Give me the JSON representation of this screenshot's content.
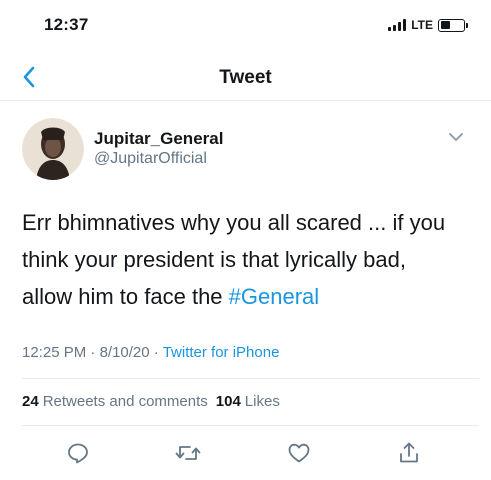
{
  "status_bar": {
    "time": "12:37",
    "network": "LTE",
    "battery_level": 0.45
  },
  "nav": {
    "back_icon": "chevron-left-icon",
    "title": "Tweet"
  },
  "tweet": {
    "author": {
      "display_name": "Jupitar_General",
      "handle": "@JupitarOfficial"
    },
    "text_before": "Err bhimnatives why you all scared ... if you think your president is that lyrically bad, allow him to face the ",
    "hashtag": "#General",
    "meta": {
      "time": "12:25 PM",
      "date": "8/10/20",
      "separator": "·",
      "source": "Twitter for iPhone"
    },
    "stats": {
      "retweets_count": "24",
      "retweets_label": "Retweets and comments",
      "likes_count": "104",
      "likes_label": "Likes"
    }
  },
  "actions": [
    "reply-icon",
    "retweet-icon",
    "like-icon",
    "share-icon"
  ],
  "colors": {
    "accent": "#1b95e0",
    "text": "#14171a",
    "secondary": "#657786",
    "divider": "#e6ecf0"
  }
}
